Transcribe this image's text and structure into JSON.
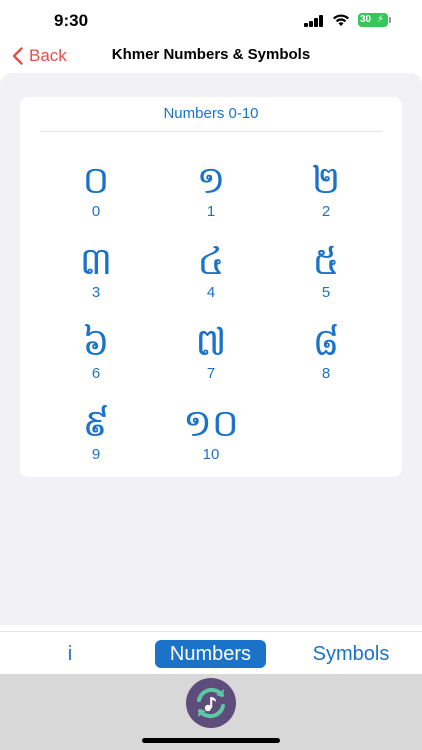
{
  "status": {
    "time": "9:30",
    "battery": "30"
  },
  "nav": {
    "back_label": "Back",
    "title": "Khmer Numbers & Symbols"
  },
  "card": {
    "title": "Numbers 0-10",
    "items": [
      {
        "glyph": "០",
        "number": "0"
      },
      {
        "glyph": "១",
        "number": "1"
      },
      {
        "glyph": "២",
        "number": "2"
      },
      {
        "glyph": "៣",
        "number": "3"
      },
      {
        "glyph": "៤",
        "number": "4"
      },
      {
        "glyph": "៥",
        "number": "5"
      },
      {
        "glyph": "៦",
        "number": "6"
      },
      {
        "glyph": "៧",
        "number": "7"
      },
      {
        "glyph": "៨",
        "number": "8"
      },
      {
        "glyph": "៩",
        "number": "9"
      },
      {
        "glyph": "១០",
        "number": "10"
      }
    ]
  },
  "tabs": {
    "info": "i",
    "numbers": "Numbers",
    "symbols": "Symbols"
  },
  "colors": {
    "accent": "#1b73c9",
    "back": "#e0514a",
    "battery": "#34c759"
  }
}
